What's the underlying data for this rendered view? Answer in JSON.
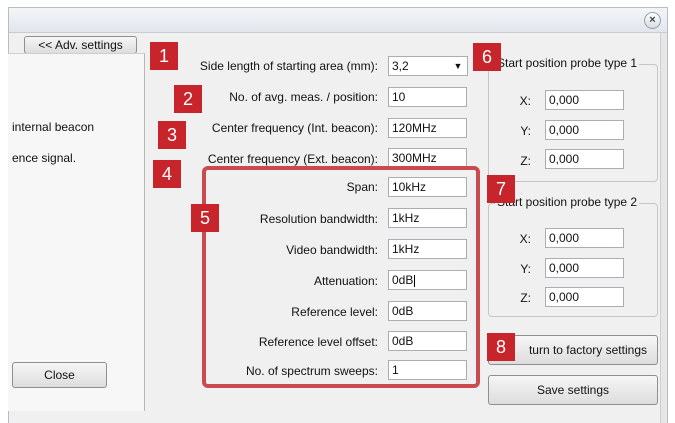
{
  "adv_settings_label": "<< Adv. settings",
  "close_label": "Close",
  "left_panel": {
    "line1": "internal beacon",
    "line2": "ence signal."
  },
  "fields": [
    {
      "label": "Side length of starting area (mm):",
      "value": "3,2"
    },
    {
      "label": "No. of avg. meas. / position:",
      "value": "10"
    },
    {
      "label": "Center frequency (Int. beacon):",
      "value": "120MHz"
    },
    {
      "label": "Center frequency (Ext. beacon):",
      "value": "300MHz"
    },
    {
      "label": "Span:",
      "value": "10kHz"
    },
    {
      "label": "Resolution bandwidth:",
      "value": "1kHz"
    },
    {
      "label": "Video bandwidth:",
      "value": "1kHz"
    },
    {
      "label": "Attenuation:",
      "value": "0dB"
    },
    {
      "label": "Reference level:",
      "value": "0dB"
    },
    {
      "label": "Reference level offset:",
      "value": "0dB"
    },
    {
      "label": "No. of spectrum sweeps:",
      "value": "1"
    }
  ],
  "probe1": {
    "title": "Start position probe type 1",
    "x_label": "X:",
    "x": "0,000",
    "y_label": "Y:",
    "y": "0,000",
    "z_label": "Z:",
    "z": "0,000"
  },
  "probe2": {
    "title": "Start position probe type 2",
    "x_label": "X:",
    "x": "0,000",
    "y_label": "Y:",
    "y": "0,000",
    "z_label": "Z:",
    "z": "0,000"
  },
  "factory_label": "turn to factory settings",
  "save_label": "Save settings",
  "badges": [
    "1",
    "2",
    "3",
    "4",
    "5",
    "6",
    "7",
    "8"
  ],
  "colors": {
    "badge": "#c8242b",
    "highlight": "#c94a4f"
  }
}
